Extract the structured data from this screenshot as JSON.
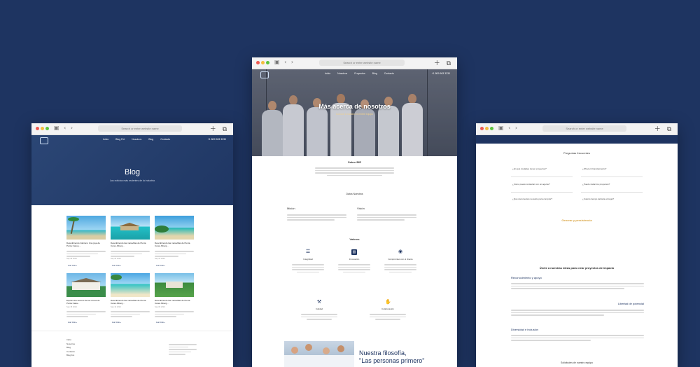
{
  "browser": {
    "url_placeholder": "Search or enter website name",
    "nav_icons": "▣ ‹ ›",
    "right_icons": "＋ ⧉"
  },
  "blog_window": {
    "nav": {
      "links": [
        "Inicio",
        "Blog Fet",
        "Nosotros",
        "Blog",
        "Contacto"
      ],
      "phone": "+1 809 963 3230"
    },
    "hero_title": "Blog",
    "hero_subtitle": "Las noticias más recientes de la industria",
    "posts": [
      {
        "title": "Descubriendo Cabrera: Una joya de Punta Cana y...",
        "date": "Sep 29 2024",
        "link": "Leer más »"
      },
      {
        "title": "Descubriendo las maravillas de Punta Cana: Alberg...",
        "date": "Sep 26 2024",
        "link": "Leer más »"
      },
      {
        "title": "Descubriendo las maravillas de Punta Cana: Alberg...",
        "date": "Sep 24 2024",
        "link": "Leer más »"
      },
      {
        "title": "Explora los tesoros de las zonas de Punta Cana...",
        "date": "Sep 15 2024",
        "link": "Leer más »"
      },
      {
        "title": "Descubriendo las maravillas de Punta Cana: Alberg...",
        "date": "Sep 12 2024",
        "link": "Leer más »"
      },
      {
        "title": "Descubriendo las maravillas de Punta Cana: Alberg...",
        "date": "Sep 06 2024",
        "link": "Leer más »"
      }
    ],
    "footer_links": [
      "Inicio",
      "Nosotros",
      "Blog",
      "Contacto",
      "Blog Fet"
    ]
  },
  "about_window": {
    "nav": {
      "links": [
        "Inicio",
        "Nosotros",
        "Proyectos",
        "Blog",
        "Contacto"
      ],
      "phone": "+1 809 963 3230"
    },
    "hero_title": "Más acerca de nosotros",
    "hero_subtitle": "Conoce a nuestro increíble equipo",
    "sobre_title": "Sobre BIE",
    "nuestra_title": "Datos Nuestros",
    "mision_label": "Misión",
    "vision_label": "Visión",
    "valores_title": "Valores",
    "values": [
      {
        "title": "Integridad",
        "icon": "list-icon"
      },
      {
        "title": "Innovación",
        "icon": "chart-icon"
      },
      {
        "title": "Compromiso con el cliente",
        "icon": "user-icon"
      },
      {
        "title": "Calidad",
        "icon": "hammer-icon"
      },
      {
        "title": "Colaboración",
        "icon": "handshake-icon"
      }
    ],
    "filosofia_title": "Nuestra filosofía,",
    "filosofia_quote": "\"Las personas primero\""
  },
  "faq_window": {
    "faq_title": "Preguntas frecuentes",
    "questions": [
      "¿En qué ciudades tienen proyectos?",
      "¿Cómo puedo contactar con un agente?",
      "¿Qué documentos necesito para comprar?",
      "¿Ofrecen financiamiento?",
      "¿Puedo visitar los proyectos?",
      "¿Cuánto tiempo tarda la entrega?"
    ],
    "accent_title": "Generar y persistencia",
    "section_title": "Únete a nuestras ideas para crear proyectos de impacto",
    "sub1": "Reconocimiento y apoyo",
    "sub2": "Libertad de potencial",
    "sub3": "Diversidad e inclusión",
    "bottom_title": "Solicitudes de nuestro equipo"
  },
  "colors": {
    "navy": "#1e3461",
    "accent": "#d9a441",
    "bg": "#1e3461"
  }
}
